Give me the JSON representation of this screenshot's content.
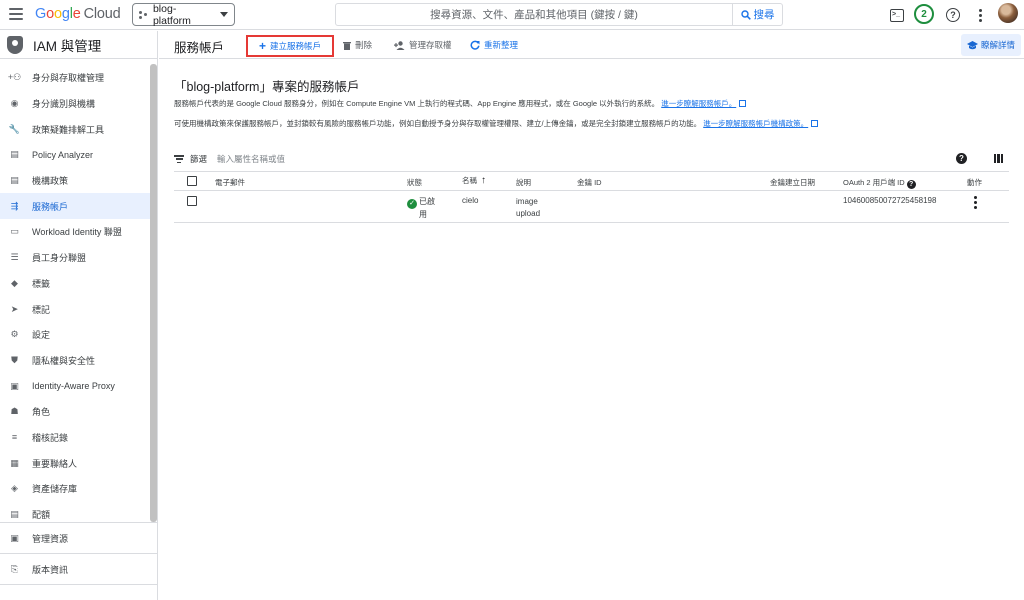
{
  "topbar": {
    "logo_letters": [
      "G",
      "o",
      "o",
      "g",
      "l",
      "e"
    ],
    "logo_suffix": "Cloud",
    "project": "blog-platform",
    "search_placeholder": "搜尋資源、文件、產品和其他項目 (鍵按 / 鍵)",
    "search_button": "搜尋",
    "notification_count": "2",
    "terminal_glyph": ">_",
    "help_glyph": "?"
  },
  "sidebar": {
    "title": "IAM 與管理",
    "items": [
      {
        "label": "身分與存取權管理",
        "icon": "person-add-icon",
        "glyph": "+⚇"
      },
      {
        "label": "身分識別與機構",
        "icon": "account-circle-icon",
        "glyph": "◉"
      },
      {
        "label": "政策疑難排解工具",
        "icon": "wrench-icon",
        "glyph": "🔧"
      },
      {
        "label": "Policy Analyzer",
        "icon": "policy-doc-icon",
        "glyph": "▤"
      },
      {
        "label": "機構政策",
        "icon": "list-box-icon",
        "glyph": "▤"
      },
      {
        "label": "服務帳戶",
        "icon": "service-account-icon",
        "glyph": "⇶",
        "active": true
      },
      {
        "label": "Workload Identity 聯盟",
        "icon": "id-card-icon",
        "glyph": "▭"
      },
      {
        "label": "員工身分聯盟",
        "icon": "list-icon",
        "glyph": "☰"
      },
      {
        "label": "標籤",
        "icon": "tag-icon",
        "glyph": "◆"
      },
      {
        "label": "標記",
        "icon": "label-icon",
        "glyph": "➤"
      },
      {
        "label": "設定",
        "icon": "settings-icon",
        "glyph": "⚙"
      },
      {
        "label": "隱私權與安全性",
        "icon": "shield-check-icon",
        "glyph": "⛊"
      },
      {
        "label": "Identity-Aware Proxy",
        "icon": "proxy-icon",
        "glyph": "▣"
      },
      {
        "label": "角色",
        "icon": "roles-icon",
        "glyph": "☗"
      },
      {
        "label": "稽核記錄",
        "icon": "audit-list-icon",
        "glyph": "≡"
      },
      {
        "label": "重要聯絡人",
        "icon": "contacts-icon",
        "glyph": "▦"
      },
      {
        "label": "資產儲存庫",
        "icon": "asset-icon",
        "glyph": "◈"
      },
      {
        "label": "配額",
        "icon": "quota-icon",
        "glyph": "▤"
      }
    ],
    "bottom_items": [
      {
        "label": "管理資源",
        "icon": "folder-icon",
        "glyph": "▣"
      },
      {
        "label": "版本資訊",
        "icon": "release-notes-icon",
        "glyph": "⎘"
      }
    ]
  },
  "main": {
    "page_title": "服務帳戶",
    "toolbar": {
      "create": "建立服務帳戶",
      "delete": "刪除",
      "manage_access": "管理存取權",
      "refresh": "重新整理",
      "learn": "瞭解詳情"
    },
    "heading": "「blog-platform」專案的服務帳戶",
    "desc1_text": "服務帳戶代表的是 Google Cloud 服務身分，例如在 Compute Engine VM 上執行的程式碼、App Engine 應用程式，或在 Google 以外執行的系統。",
    "desc1_link": "進一步瞭解服務帳戶。",
    "desc2_text": "可使用機構政策來保護服務帳戶，並封鎖較有風險的服務帳戶功能，例如自動授予身分與存取權管理權限、建立/上傳金鑰，或是完全封鎖建立服務帳戶的功能。",
    "desc2_link": "進一步瞭解服務帳戶機構政策。",
    "filter": {
      "label": "篩選",
      "placeholder": "輸入屬性名稱或值"
    },
    "table": {
      "headers": {
        "email": "電子郵件",
        "status": "狀態",
        "name": "名稱",
        "description": "說明",
        "key_id": "金鑰 ID",
        "key_created": "金鑰建立日期",
        "oauth": "OAuth 2 用戶端 ID",
        "actions": "動作"
      },
      "rows": [
        {
          "email": "",
          "status_line1": "已啟",
          "status_line2": "用",
          "name": "cielo",
          "description_line1": "image",
          "description_line2": "upload",
          "key_id": "",
          "key_created": "",
          "oauth": "104600850072725458198"
        }
      ]
    }
  }
}
